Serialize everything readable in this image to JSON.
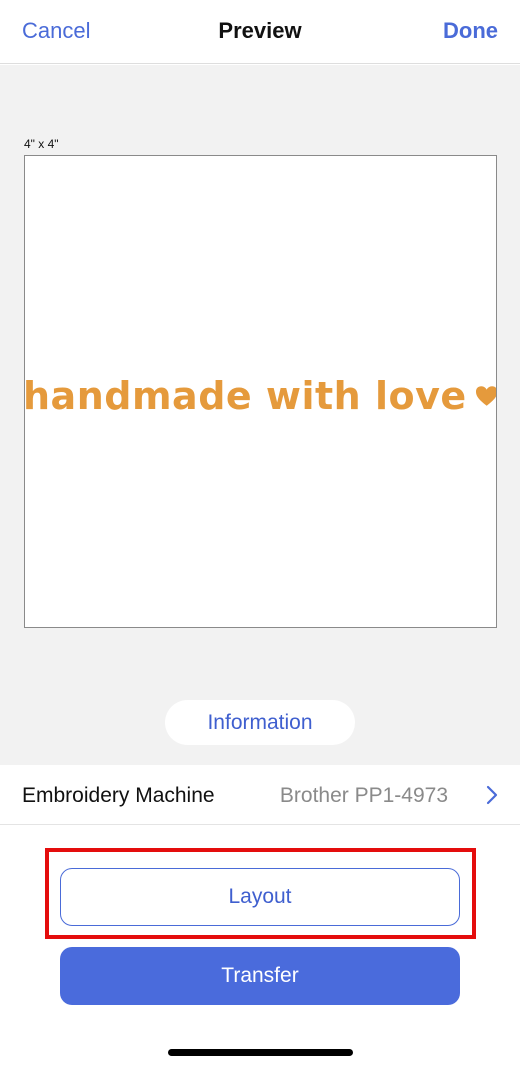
{
  "navbar": {
    "cancel_label": "Cancel",
    "title": "Preview",
    "done_label": "Done"
  },
  "preview": {
    "hoop_size": "4\" x 4\"",
    "design_text": "handmade with love",
    "design_color": "#e59a3c"
  },
  "info_button_label": "Information",
  "machine": {
    "label": "Embroidery Machine",
    "value": "Brother PP1-4973"
  },
  "buttons": {
    "layout_label": "Layout",
    "transfer_label": "Transfer"
  },
  "colors": {
    "accent": "#4a6bd8",
    "highlight": "#e40d0d"
  },
  "icons": {
    "heart": "heart-icon",
    "chevron": "chevron-right-icon"
  }
}
